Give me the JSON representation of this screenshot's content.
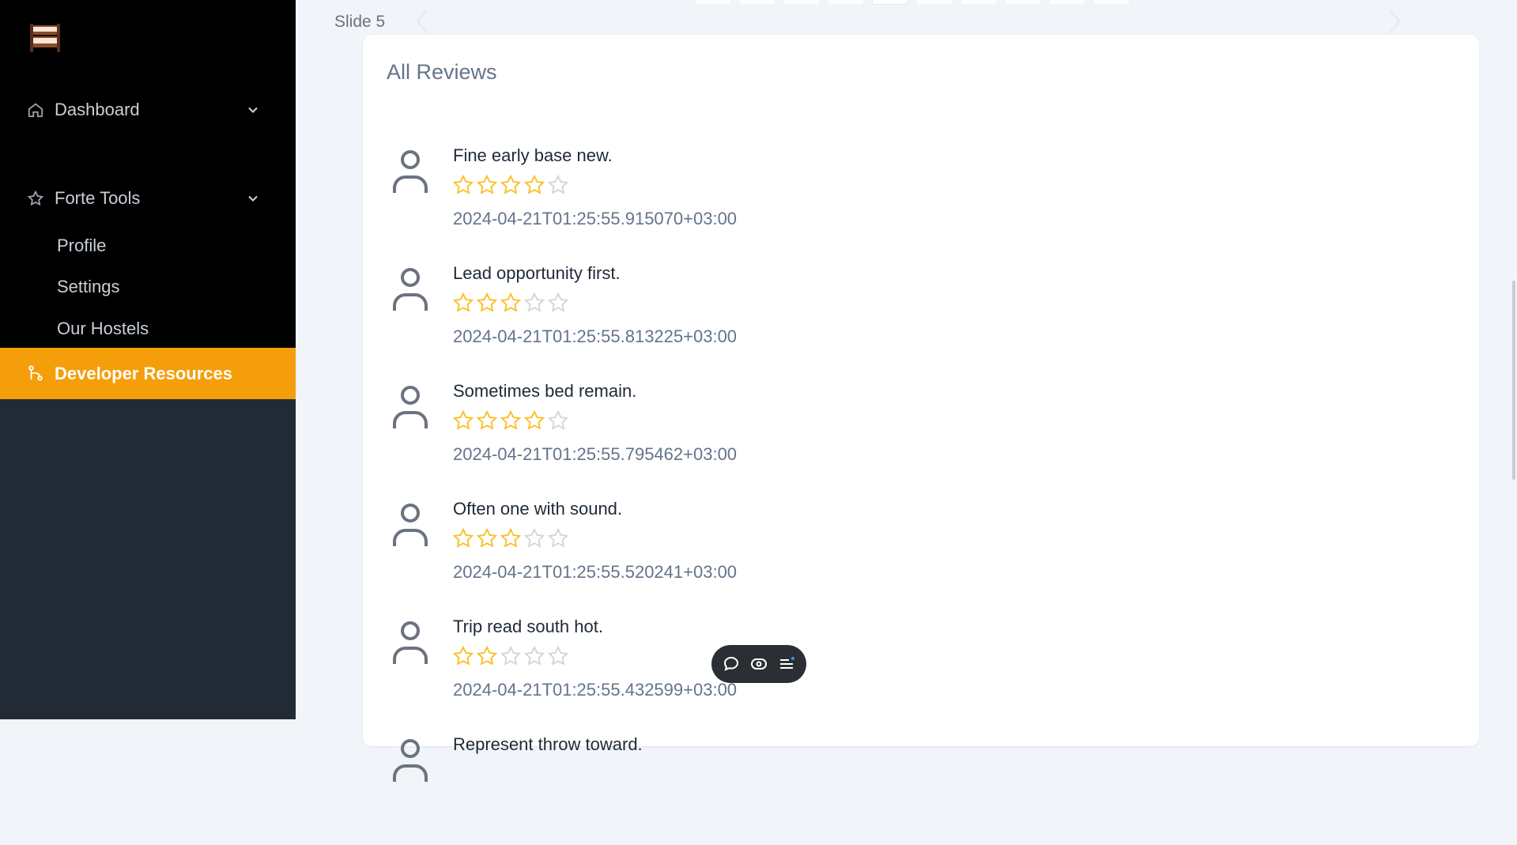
{
  "sidebar": {
    "logo_icon": "hostel-bunk-bed-logo",
    "groups": [
      {
        "label": "Dashboard",
        "icon": "home-icon"
      },
      {
        "label": "Forte Tools",
        "icon": "star-icon"
      }
    ],
    "sub_items": [
      {
        "label": "Profile"
      },
      {
        "label": "Settings"
      },
      {
        "label": "Our Hostels"
      }
    ],
    "active_item": {
      "label": "Developer Resources",
      "icon": "git-branch-icon"
    },
    "colors": {
      "top_bg": "#000000",
      "bottom_bg": "#222a35",
      "active_bg": "#f59e0b"
    }
  },
  "carousel": {
    "slide_label": "Slide 5",
    "dot_count": 10,
    "active_dot": 5
  },
  "reviews": {
    "title": "All Reviews",
    "items": [
      {
        "text": "Fine early base new.",
        "rating": 4,
        "date": "2024-04-21T01:25:55.915070+03:00"
      },
      {
        "text": "Lead opportunity first.",
        "rating": 3,
        "date": "2024-04-21T01:25:55.813225+03:00"
      },
      {
        "text": "Sometimes bed remain.",
        "rating": 4,
        "date": "2024-04-21T01:25:55.795462+03:00"
      },
      {
        "text": "Often one with sound.",
        "rating": 3,
        "date": "2024-04-21T01:25:55.520241+03:00"
      },
      {
        "text": "Trip read south hot.",
        "rating": 2,
        "date": "2024-04-21T01:25:55.432599+03:00"
      },
      {
        "text": "Represent throw toward.",
        "rating": 0,
        "date": ""
      }
    ],
    "star_color": "#fbbf24",
    "star_empty_color": "#d1d5db"
  },
  "floating_toolbar": {
    "buttons": [
      "chat-bubble-icon",
      "eye-toggle-icon",
      "menu-list-icon"
    ]
  }
}
